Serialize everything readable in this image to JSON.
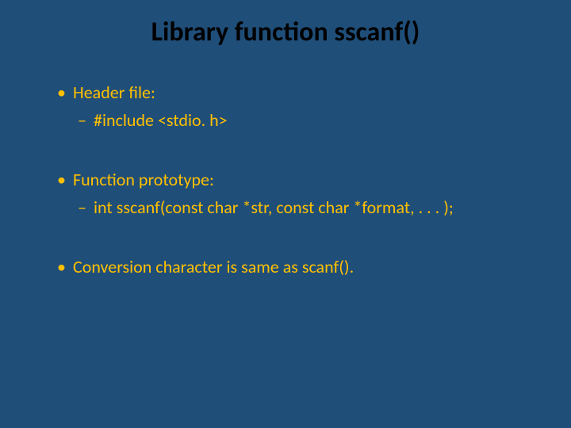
{
  "slide": {
    "title": "Library function sscanf()",
    "groups": [
      {
        "heading": "Header file:",
        "sub": "#include <stdio. h>"
      },
      {
        "heading": "Function prototype:",
        "sub": "int sscanf(const char *str, const char *format, . . . );"
      },
      {
        "heading": "Conversion character is same as scanf().",
        "sub": null
      }
    ]
  }
}
